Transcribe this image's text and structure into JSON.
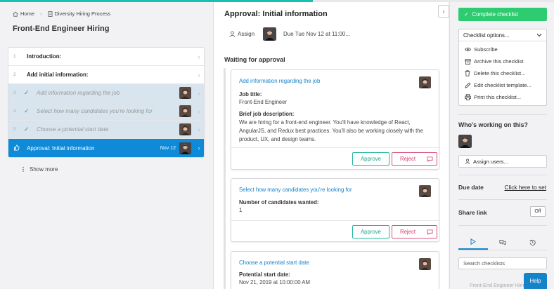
{
  "progress": {
    "fraction": 0.565,
    "color": "#17c0b2"
  },
  "breadcrumb": {
    "home": "Home",
    "process": "Diversity Hiring Process"
  },
  "checklist_title": "Front-End Engineer Hiring",
  "tasks": [
    {
      "num": "1",
      "label": "Introduction:",
      "state": "heading"
    },
    {
      "num": "2",
      "label": "Add initial information:",
      "state": "heading"
    },
    {
      "num": "3",
      "label": "Add information regarding the job",
      "state": "done"
    },
    {
      "num": "4",
      "label": "Select how many candidates you're looking for",
      "state": "done"
    },
    {
      "num": "5",
      "label": "Choose a potential start date",
      "state": "done"
    },
    {
      "num": "",
      "label": "Approval: Initial information",
      "state": "active",
      "date": "Nov 12"
    }
  ],
  "show_more": "Show more",
  "main": {
    "title": "Approval: Initial information",
    "assign": "Assign",
    "due": "Due Tue Nov 12 at 11:00...",
    "waiting": "Waiting for approval",
    "cards": [
      {
        "title": "Add information regarding the job",
        "fields": [
          {
            "label": "Job title:",
            "value": "Front-End Engineer"
          },
          {
            "label": "Brief job description:",
            "value": "We are hiring for a front-end engineer. You'll have knowledge of React, AngularJS, and Redux best practices. You'll also be working closely with the product, UX, and design teams."
          }
        ],
        "approve": "Approve",
        "reject": "Reject"
      },
      {
        "title": "Select how many candidates you're looking for",
        "fields": [
          {
            "label": "Number of candidates wanted:",
            "value": "1"
          }
        ],
        "approve": "Approve",
        "reject": "Reject"
      },
      {
        "title": "Choose a potential start date",
        "fields": [
          {
            "label": "Potential start date:",
            "value": "Nov 21, 2019 at 10:00:00 AM"
          }
        ]
      }
    ]
  },
  "sidebar": {
    "complete": "Complete checklist",
    "options_label": "Checklist options...",
    "options": [
      {
        "icon": "eye-icon",
        "label": "Subscribe"
      },
      {
        "icon": "archive-icon",
        "label": "Archive this checklist"
      },
      {
        "icon": "trash-icon",
        "label": "Delete this checklist..."
      },
      {
        "icon": "pencil-icon",
        "label": "Edit checklist template..."
      },
      {
        "icon": "print-icon",
        "label": "Print this checklist..."
      }
    ],
    "working_title": "Who's working on this?",
    "assign_users": "Assign users...",
    "due_label": "Due date",
    "due_link": "Click here to set",
    "share_label": "Share link",
    "share_state": "Off",
    "search_placeholder": "Search checklists",
    "recent": "Front-End Engineer Hiring"
  },
  "help": "Help",
  "colors": {
    "accent": "#17c0b2",
    "active_task": "#0e8ad8",
    "complete": "#2ecc71",
    "approve": "#25b59e",
    "reject": "#d7537a",
    "link": "#1583c8"
  }
}
